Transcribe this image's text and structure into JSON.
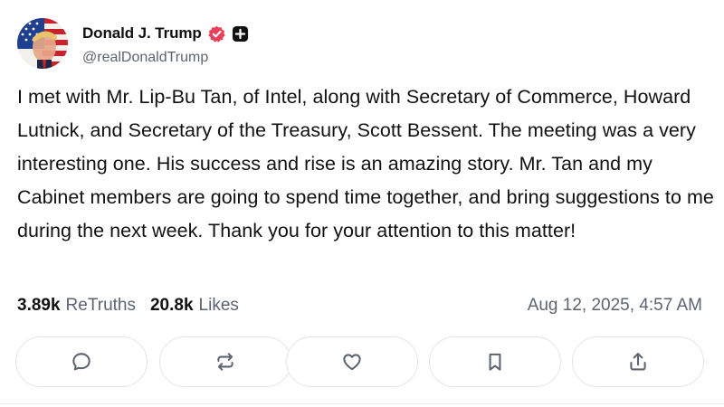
{
  "post": {
    "author": {
      "display_name": "Donald J. Trump",
      "handle": "@realDonaldTrump",
      "verified": true,
      "avatar_icon": "avatar-flag-portrait"
    },
    "text": "I met with Mr. Lip-Bu Tan, of Intel, along with Secretary of Commerce, Howard Lutnick, and Secretary of the Treasury, Scott Bessent. The meeting was a very interesting one. His success and rise is an amazing story. Mr. Tan and my Cabinet members are going to spend time together, and bring suggestions to me during the next week. Thank you for your attention to this matter!",
    "stats": {
      "retruths_count": "3.89k",
      "retruths_label": "ReTruths",
      "likes_count": "20.8k",
      "likes_label": "Likes"
    },
    "timestamp": "Aug 12, 2025, 4:57 AM"
  },
  "actions": [
    {
      "name": "reply",
      "icon": "comment-icon"
    },
    {
      "name": "retruth",
      "icon": "repost-icon"
    },
    {
      "name": "like",
      "icon": "heart-icon"
    },
    {
      "name": "bookmark",
      "icon": "bookmark-icon"
    },
    {
      "name": "share",
      "icon": "share-icon"
    }
  ],
  "colors": {
    "verified_badge": "#e8405a",
    "text_primary": "#111111",
    "text_secondary": "#5b6470",
    "button_border": "#e3e5e8"
  }
}
